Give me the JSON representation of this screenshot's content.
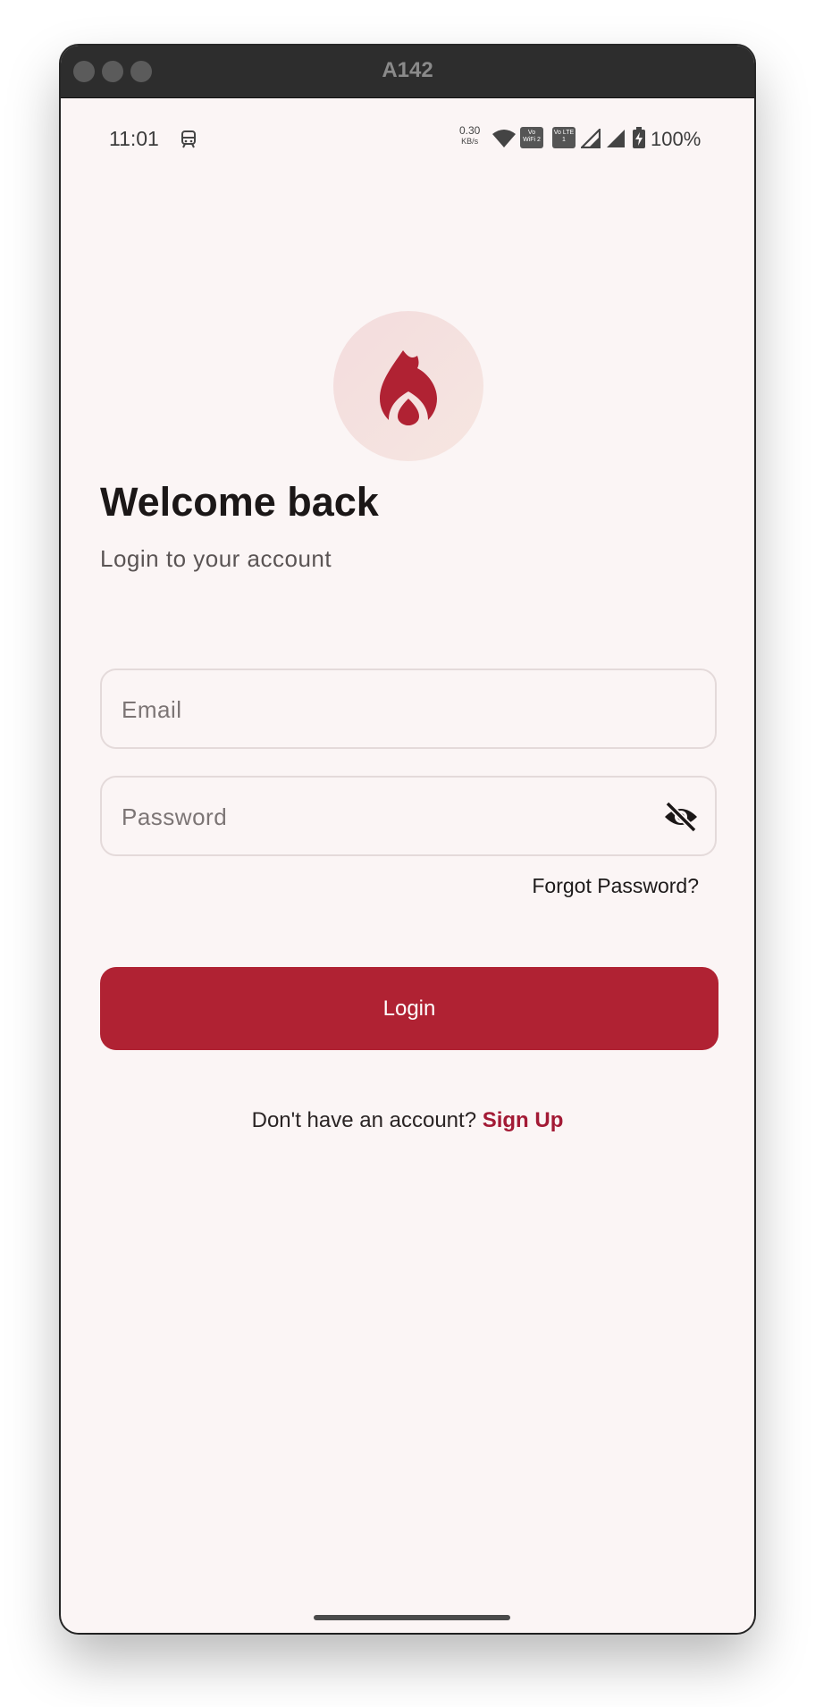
{
  "window": {
    "title": "A142"
  },
  "status_bar": {
    "time": "11:01",
    "net_speed_value": "0.30",
    "net_speed_unit": "KB/s",
    "vowifi_badge": "Vo WiFi 2",
    "volte_badge": "Vo LTE 1",
    "battery_percent": "100%",
    "icons": [
      "train-icon",
      "wifi-icon",
      "vowifi-icon",
      "volte-icon",
      "signal-icon",
      "signal-icon",
      "battery-charging-icon"
    ]
  },
  "logo": {
    "icon": "flame-icon",
    "color": "#b02233"
  },
  "login": {
    "heading": "Welcome back",
    "subheading": "Login to your account",
    "email_placeholder": "Email",
    "email_value": "",
    "password_placeholder": "Password",
    "password_value": "",
    "password_toggle_icon": "eye-off-icon",
    "forgot_password": "Forgot Password?",
    "login_button": "Login",
    "no_account_text": "Don't have an account?",
    "signup_link": "Sign Up"
  },
  "colors": {
    "primary": "#b02233",
    "link": "#a31a35",
    "background": "#fbf5f5"
  }
}
